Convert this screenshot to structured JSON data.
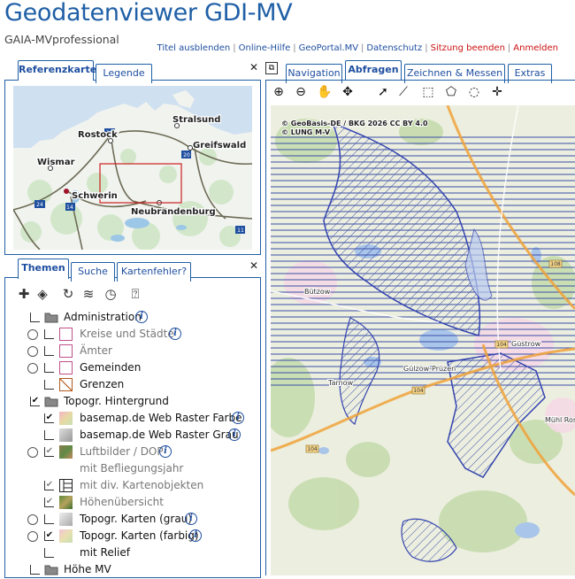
{
  "header": {
    "title": "Geodatenviewer GDI-MV",
    "subtitle": "GAIA-MVprofessional",
    "links": [
      {
        "label": "Titel ausblenden",
        "color": "blue"
      },
      {
        "label": "Online-Hilfe",
        "color": "blue"
      },
      {
        "label": "GeoPortal.MV",
        "color": "blue"
      },
      {
        "label": "Datenschutz",
        "color": "blue"
      },
      {
        "label": "Sitzung beenden",
        "color": "red"
      },
      {
        "label": "Anmelden",
        "color": "red"
      }
    ]
  },
  "refpanel": {
    "tabs": [
      "Referenzkarte",
      "Legende"
    ],
    "close": "✕",
    "cities": [
      "Stralsund",
      "Rostock",
      "Greifswald",
      "Wismar",
      "Schwerin",
      "Neubrandenburg"
    ],
    "roads": [
      "19",
      "20",
      "24",
      "14",
      "11"
    ]
  },
  "themepanel": {
    "tabs": [
      "Themen",
      "Suche",
      "Kartenfehler?"
    ],
    "close": "✕",
    "tools": [
      "add-layer",
      "layers",
      "refresh",
      "layers-stack",
      "clock",
      "help"
    ],
    "rows": [
      {
        "label": "Administration",
        "grey": false,
        "info": true
      },
      {
        "label": "Kreise und Städte",
        "grey": true,
        "info": true
      },
      {
        "label": "Ämter",
        "grey": true,
        "info": false
      },
      {
        "label": "Gemeinden",
        "grey": false,
        "info": false
      },
      {
        "label": "Grenzen",
        "grey": false,
        "info": false
      },
      {
        "label": "Topogr. Hintergrund",
        "grey": false,
        "info": false
      },
      {
        "label": "basemap.de Web Raster Farbe",
        "grey": false,
        "info": true
      },
      {
        "label": "basemap.de Web Raster Grau",
        "grey": false,
        "info": true
      },
      {
        "label": "Luftbilder / DOP",
        "grey": true,
        "info": true
      },
      {
        "label": "mit Befliegungsjahr",
        "grey": true,
        "info": false
      },
      {
        "label": "mit div. Kartenobjekten",
        "grey": true,
        "info": false
      },
      {
        "label": "Höhenübersicht",
        "grey": true,
        "info": false
      },
      {
        "label": "Topogr. Karten (grau)",
        "grey": false,
        "info": true
      },
      {
        "label": "Topogr. Karten (farbig)",
        "grey": false,
        "info": true
      },
      {
        "label": "mit Relief",
        "grey": false,
        "info": false
      },
      {
        "label": "Höhe MV",
        "grey": false,
        "info": false
      }
    ]
  },
  "mappanel": {
    "tabs": [
      "Navigation",
      "Abfragen",
      "Zeichnen & Messen",
      "Extras"
    ],
    "active_tab": "Abfragen",
    "attribution": [
      "© GeoBasis-DE / BKG 2026 CC BY 4.0",
      "© LUNG M-V"
    ],
    "places": [
      "Bützow",
      "Güstrow",
      "Gülzow-Prüzen",
      "Tarnow",
      "Mühl Rosin"
    ],
    "roads": [
      "108",
      "104",
      "104",
      "104"
    ]
  }
}
